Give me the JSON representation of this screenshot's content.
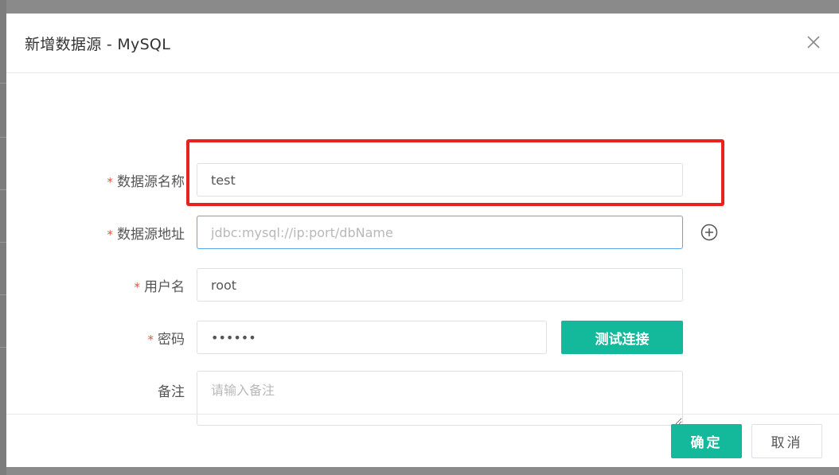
{
  "dialog": {
    "title": "新增数据源 - MySQL"
  },
  "form": {
    "name": {
      "label": "数据源名称",
      "value": "test",
      "required": true
    },
    "url": {
      "label": "数据源地址",
      "value": "",
      "placeholder": "jdbc:mysql://ip:port/dbName",
      "required": true
    },
    "username": {
      "label": "用户名",
      "value": "root",
      "required": true
    },
    "password": {
      "label": "密码",
      "value": "aaaaaa",
      "required": true
    },
    "remark": {
      "label": "备注",
      "value": "",
      "placeholder": "请输入备注",
      "required": false
    },
    "required_mark": "*",
    "test_button": "测试连接"
  },
  "footer": {
    "ok_label": "确定",
    "cancel_label": "取消"
  },
  "icons": {
    "close": "close-icon",
    "add": "plus-circle-icon"
  },
  "colors": {
    "primary": "#14b89a",
    "required": "#e4543a",
    "highlight": "#e8231e",
    "focus_border": "#5aa9e6"
  }
}
